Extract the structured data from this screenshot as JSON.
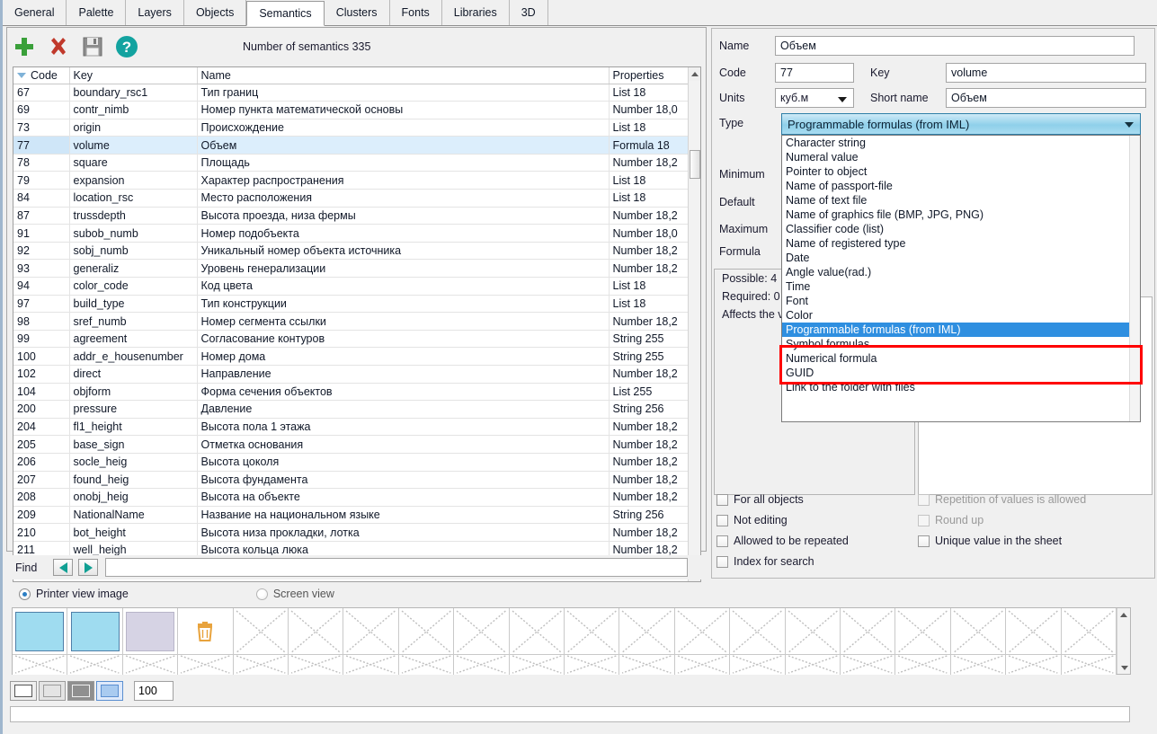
{
  "tabs": [
    {
      "label": "General",
      "active": false
    },
    {
      "label": "Palette",
      "active": false
    },
    {
      "label": "Layers",
      "active": false
    },
    {
      "label": "Objects",
      "active": false
    },
    {
      "label": "Semantics",
      "active": true
    },
    {
      "label": "Clusters",
      "active": false
    },
    {
      "label": "Fonts",
      "active": false
    },
    {
      "label": "Libraries",
      "active": false
    },
    {
      "label": "3D",
      "active": false
    }
  ],
  "toolbar": {
    "add_title": "add-semantic",
    "delete_title": "delete-semantic",
    "save_title": "save",
    "help_title": "help",
    "count_label": "Number of semantics 335"
  },
  "table": {
    "headers": {
      "code": "Code",
      "key": "Key",
      "name": "Name",
      "properties": "Properties"
    },
    "rows": [
      {
        "code": "67",
        "key": "boundary_rsc1",
        "name": "Тип границ",
        "properties": "List 18",
        "selected": false
      },
      {
        "code": "69",
        "key": "contr_nimb",
        "name": "Номер пункта математической основы",
        "properties": "Number 18,0",
        "selected": false
      },
      {
        "code": "73",
        "key": "origin",
        "name": "Происхождение",
        "properties": "List 18",
        "selected": false
      },
      {
        "code": "77",
        "key": "volume",
        "name": "Объем",
        "properties": "Formula 18",
        "selected": true
      },
      {
        "code": "78",
        "key": "square",
        "name": "Площадь",
        "properties": "Number 18,2",
        "selected": false
      },
      {
        "code": "79",
        "key": "expansion",
        "name": "Характер распространения",
        "properties": "List 18",
        "selected": false
      },
      {
        "code": "84",
        "key": "location_rsc",
        "name": "Место расположения",
        "properties": "List 18",
        "selected": false
      },
      {
        "code": "87",
        "key": "trussdepth",
        "name": "Высота проезда, низа фермы",
        "properties": "Number 18,2",
        "selected": false
      },
      {
        "code": "91",
        "key": "subob_numb",
        "name": "Номер подобъекта",
        "properties": "Number 18,0",
        "selected": false
      },
      {
        "code": "92",
        "key": "sobj_numb",
        "name": "Уникальный номер объекта источника",
        "properties": "Number 18,2",
        "selected": false
      },
      {
        "code": "93",
        "key": "generaliz",
        "name": "Уровень генерализации",
        "properties": "Number 18,2",
        "selected": false
      },
      {
        "code": "94",
        "key": "color_code",
        "name": "Код цвета",
        "properties": "List 18",
        "selected": false
      },
      {
        "code": "97",
        "key": "build_type",
        "name": "Тип конструкции",
        "properties": "List 18",
        "selected": false
      },
      {
        "code": "98",
        "key": "sref_numb",
        "name": "Номер сегмента ссылки",
        "properties": "Number 18,2",
        "selected": false
      },
      {
        "code": "99",
        "key": "agreement",
        "name": "Согласование контуров",
        "properties": "String 255",
        "selected": false
      },
      {
        "code": "100",
        "key": "addr_e_housenumber",
        "name": "Номер дома",
        "properties": "String 255",
        "selected": false
      },
      {
        "code": "102",
        "key": "direct",
        "name": "Направление",
        "properties": "Number 18,2",
        "selected": false
      },
      {
        "code": "104",
        "key": "objform",
        "name": "Форма сечения объектов",
        "properties": "List 255",
        "selected": false
      },
      {
        "code": "200",
        "key": "pressure",
        "name": "Давление",
        "properties": "String 256",
        "selected": false
      },
      {
        "code": "204",
        "key": "fl1_height",
        "name": "Высота пола 1 этажа",
        "properties": "Number 18,2",
        "selected": false
      },
      {
        "code": "205",
        "key": "base_sign",
        "name": "Отметка основания",
        "properties": "Number 18,2",
        "selected": false
      },
      {
        "code": "206",
        "key": "socle_heig",
        "name": "Высота цоколя",
        "properties": "Number 18,2",
        "selected": false
      },
      {
        "code": "207",
        "key": "found_heig",
        "name": "Высота фундамента",
        "properties": "Number 18,2",
        "selected": false
      },
      {
        "code": "208",
        "key": "onobj_heig",
        "name": "Высота на объекте",
        "properties": "Number 18,2",
        "selected": false
      },
      {
        "code": "209",
        "key": "NationalName",
        "name": "Название на национальном языке",
        "properties": "String 256",
        "selected": false
      },
      {
        "code": "210",
        "key": "bot_height",
        "name": "Высота низа прокладки, лотка",
        "properties": "Number 18,2",
        "selected": false
      },
      {
        "code": "211",
        "key": "well_heigh",
        "name": "Высота кольца люка",
        "properties": "Number 18,2",
        "selected": false
      }
    ]
  },
  "find": {
    "label": "Find",
    "value": "",
    "prev_title": "find-previous",
    "next_title": "find-next"
  },
  "view_modes": [
    {
      "label": "Printer view image",
      "selected": true
    },
    {
      "label": "Screen view",
      "selected": false
    }
  ],
  "palette": {
    "cells": [
      {
        "kind": "blue"
      },
      {
        "kind": "blue"
      },
      {
        "kind": "lavender"
      },
      {
        "kind": "trash"
      },
      {
        "kind": "empty"
      },
      {
        "kind": "empty"
      },
      {
        "kind": "empty"
      },
      {
        "kind": "empty"
      },
      {
        "kind": "empty"
      },
      {
        "kind": "empty"
      },
      {
        "kind": "empty"
      },
      {
        "kind": "empty"
      },
      {
        "kind": "empty"
      },
      {
        "kind": "empty"
      },
      {
        "kind": "empty"
      },
      {
        "kind": "empty"
      },
      {
        "kind": "empty"
      },
      {
        "kind": "empty"
      },
      {
        "kind": "empty"
      },
      {
        "kind": "empty"
      }
    ],
    "opacity_value": "100"
  },
  "properties": {
    "name_label": "Name",
    "name_value": "Объем",
    "code_label": "Code",
    "code_value": "77",
    "key_label": "Key",
    "key_value": "volume",
    "units_label": "Units",
    "units_value": "куб.м",
    "short_name_label": "Short name",
    "short_name_value": "Объем",
    "type_label": "Type",
    "type_value": "Programmable formulas (from IML)",
    "minimum_label": "Minimum",
    "minimum_value": "",
    "default_label": "Default",
    "default_value": "",
    "maximum_label": "Maximum",
    "maximum_value": "",
    "formula_label": "Formula",
    "formula_value": "",
    "stats": [
      "Possible: 4",
      "Required: 0",
      "Affects the v"
    ]
  },
  "type_options": [
    {
      "label": "Character string",
      "selected": false
    },
    {
      "label": "Numeral value",
      "selected": false
    },
    {
      "label": "Pointer to object",
      "selected": false
    },
    {
      "label": "Name of passport-file",
      "selected": false
    },
    {
      "label": "Name of text file",
      "selected": false
    },
    {
      "label": "Name of graphics file (BMP, JPG, PNG)",
      "selected": false
    },
    {
      "label": "Classifier code (list)",
      "selected": false
    },
    {
      "label": "Name of registered type",
      "selected": false
    },
    {
      "label": "Date",
      "selected": false
    },
    {
      "label": "Angle value(rad.)",
      "selected": false
    },
    {
      "label": "Time",
      "selected": false
    },
    {
      "label": "Font",
      "selected": false
    },
    {
      "label": "Color",
      "selected": false
    },
    {
      "label": "Programmable formulas (from IML)",
      "selected": true
    },
    {
      "label": "Symbol formulas",
      "selected": false
    },
    {
      "label": "Numerical formula",
      "selected": false
    },
    {
      "label": "GUID",
      "selected": false
    },
    {
      "label": "Link to the folder with files",
      "selected": false
    }
  ],
  "checkboxes_left": [
    {
      "label": "For all objects",
      "checked": false,
      "disabled": false
    },
    {
      "label": "Not editing",
      "checked": false,
      "disabled": false
    },
    {
      "label": "Allowed to be repeated",
      "checked": false,
      "disabled": false
    },
    {
      "label": "Index for search",
      "checked": false,
      "disabled": false
    }
  ],
  "checkboxes_right": [
    {
      "label": "Repetition of values is allowed",
      "checked": false,
      "disabled": true
    },
    {
      "label": "Round up",
      "checked": false,
      "disabled": true
    },
    {
      "label": "Unique value in the sheet",
      "checked": false,
      "disabled": false
    }
  ],
  "colors": {
    "accent_blue": "#2f8fe0",
    "selection_row": "#dceefc",
    "highlight_red": "#ff0000",
    "teal": "#11a094",
    "swatch_blue": "#9fdcf0",
    "swatch_lavender": "#d6d3e4"
  }
}
